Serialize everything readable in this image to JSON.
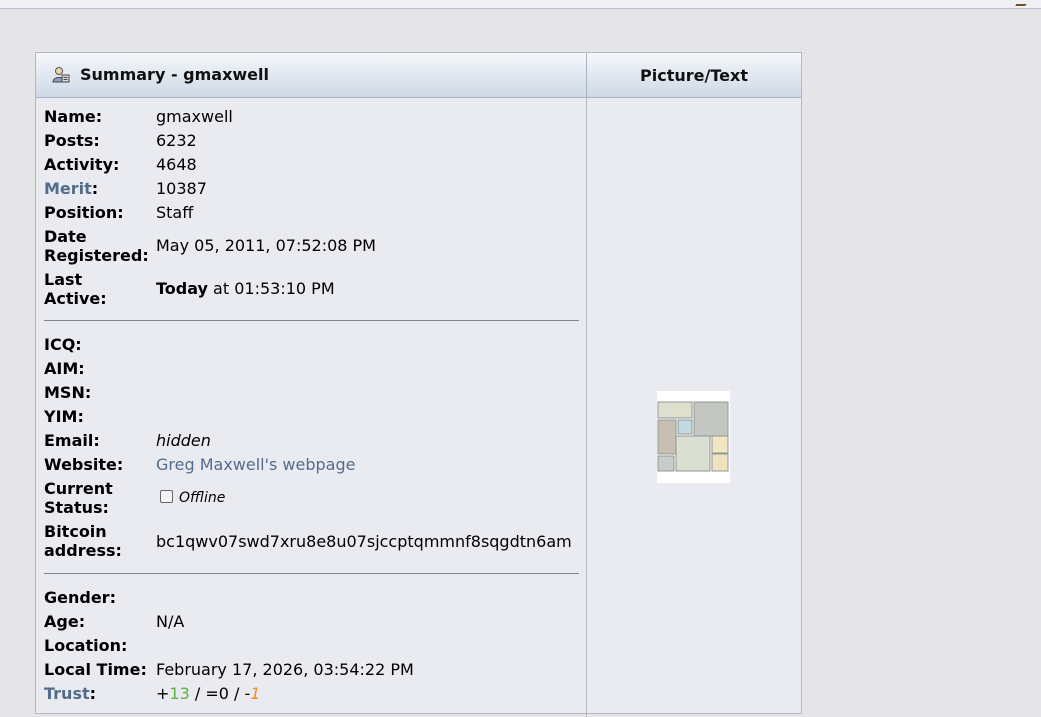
{
  "header": {
    "summary_title": "Summary - gmaxwell",
    "picture_title": "Picture/Text"
  },
  "profile": {
    "name_label": "Name:",
    "name": "gmaxwell",
    "posts_label": "Posts:",
    "posts": "6232",
    "activity_label": "Activity:",
    "activity": "4648",
    "merit_label": "Merit",
    "merit_colon": ":",
    "merit": "10387",
    "position_label": "Position:",
    "position": "Staff",
    "date_registered_label_1": "Date",
    "date_registered_label_2": "Registered:",
    "date_registered": "May 05, 2011, 07:52:08 PM",
    "last_active_label_1": "Last",
    "last_active_label_2": "Active:",
    "last_active_day": "Today",
    "last_active_time": " at 01:53:10 PM"
  },
  "contact": {
    "icq_label": "ICQ:",
    "aim_label": "AIM:",
    "msn_label": "MSN:",
    "yim_label": "YIM:",
    "email_label": "Email:",
    "email": "hidden",
    "website_label": "Website:",
    "website": "Greg Maxwell's webpage",
    "status_label_1": "Current",
    "status_label_2": "Status:",
    "status": "Offline",
    "bitcoin_label_1": "Bitcoin",
    "bitcoin_label_2": "address:",
    "bitcoin": "bc1qwv07swd7xru8e8u07sjccptqmmnf8sqgdtn6am"
  },
  "personal": {
    "gender_label": "Gender:",
    "age_label": "Age:",
    "age": "N/A",
    "location_label": "Location:",
    "local_time_label": "Local Time:",
    "local_time": "February 17, 2026, 03:54:22 PM",
    "trust_label": "Trust",
    "trust_colon": ":",
    "trust_plus": "+",
    "trust_positive": "13",
    "trust_mid": " / =0 / -",
    "trust_negative": "1"
  },
  "colors": {
    "link": "#536c8c",
    "trust_positive": "#5ab43c",
    "trust_negative": "#f08c1c"
  }
}
